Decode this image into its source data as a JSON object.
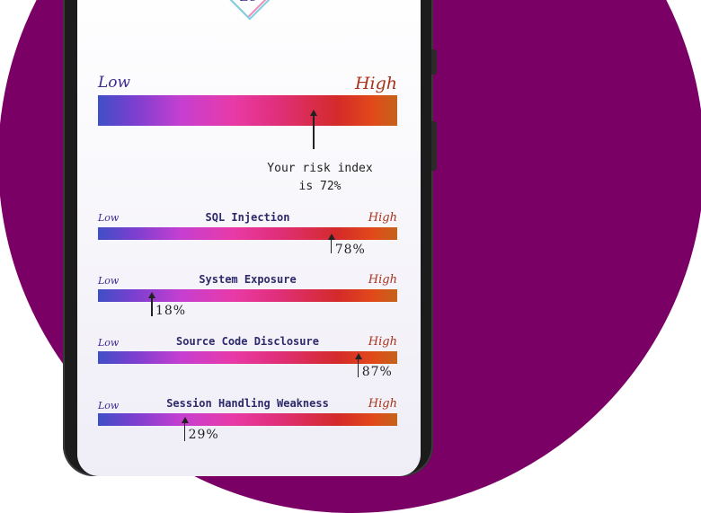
{
  "logo": {
    "text": "ZC",
    "icon": "zc-logo-diamond-icon"
  },
  "overall": {
    "low_label": "Low",
    "high_label": "High",
    "risk_line1": "Your risk index",
    "risk_line2": "is 72%",
    "value": 72
  },
  "metrics": [
    {
      "title": "SQL Injection",
      "low": "Low",
      "high": "High",
      "value_label": "78%",
      "value": 78
    },
    {
      "title": "System Exposure",
      "low": "Low",
      "high": "High",
      "value_label": "18%",
      "value": 18
    },
    {
      "title": "Source Code Disclosure",
      "low": "Low",
      "high": "High",
      "value_label": "87%",
      "value": 87
    },
    {
      "title": "Session Handling Weakness",
      "low": "Low",
      "high": "High",
      "value_label": "29%",
      "value": 29
    }
  ],
  "colors": {
    "background_circle": "#7b0066",
    "low_label": "#3d2a8e",
    "high_label": "#a8341c"
  }
}
